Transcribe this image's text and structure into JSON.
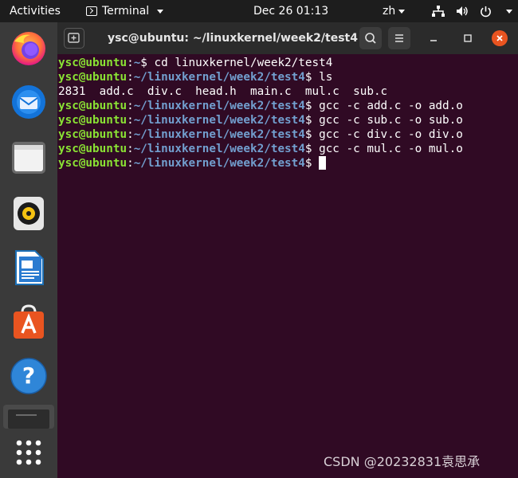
{
  "topbar": {
    "activities": "Activities",
    "app_name": "Terminal",
    "app_icon": "terminal-icon",
    "clock": "Dec 26  01:13",
    "language": "zh",
    "status_icons": [
      "network-icon",
      "volume-icon",
      "power-icon"
    ]
  },
  "dock": {
    "apps": [
      "firefox-icon",
      "thunderbird-icon",
      "files-icon",
      "rhythmbox-icon",
      "libreoffice-writer-icon",
      "software-center-icon",
      "help-icon",
      "terminal-icon",
      "show-applications-icon"
    ]
  },
  "window": {
    "title": "ysc@ubuntu: ~/linuxkernel/week2/test4",
    "header_buttons": [
      "new-tab-icon",
      "search-icon",
      "menu-icon",
      "minimize-icon",
      "maximize-icon",
      "close-icon"
    ]
  },
  "terminal": {
    "lines": [
      {
        "user": "ysc@ubuntu",
        "sep": ":",
        "path": "~",
        "prompt": "$ ",
        "cmd": "cd linuxkernel/week2/test4"
      },
      {
        "user": "ysc@ubuntu",
        "sep": ":",
        "path": "~/linuxkernel/week2/test4",
        "prompt": "$ ",
        "cmd": "ls"
      },
      {
        "output": "2831  add.c  div.c  head.h  main.c  mul.c  sub.c"
      },
      {
        "user": "ysc@ubuntu",
        "sep": ":",
        "path": "~/linuxkernel/week2/test4",
        "prompt": "$ ",
        "cmd": "gcc -c add.c -o add.o"
      },
      {
        "user": "ysc@ubuntu",
        "sep": ":",
        "path": "~/linuxkernel/week2/test4",
        "prompt": "$ ",
        "cmd": "gcc -c sub.c -o sub.o"
      },
      {
        "user": "ysc@ubuntu",
        "sep": ":",
        "path": "~/linuxkernel/week2/test4",
        "prompt": "$ ",
        "cmd": "gcc -c div.c -o div.o"
      },
      {
        "user": "ysc@ubuntu",
        "sep": ":",
        "path": "~/linuxkernel/week2/test4",
        "prompt": "$ ",
        "cmd": "gcc -c mul.c -o mul.o"
      },
      {
        "user": "ysc@ubuntu",
        "sep": ":",
        "path": "~/linuxkernel/week2/test4",
        "prompt": "$ ",
        "cmd": ""
      }
    ]
  },
  "watermark": "CSDN @20232831袁思承",
  "colors": {
    "terminal_bg": "#300a24",
    "user": "#8ae234",
    "path": "#729fcf",
    "close_button": "#e95420"
  }
}
